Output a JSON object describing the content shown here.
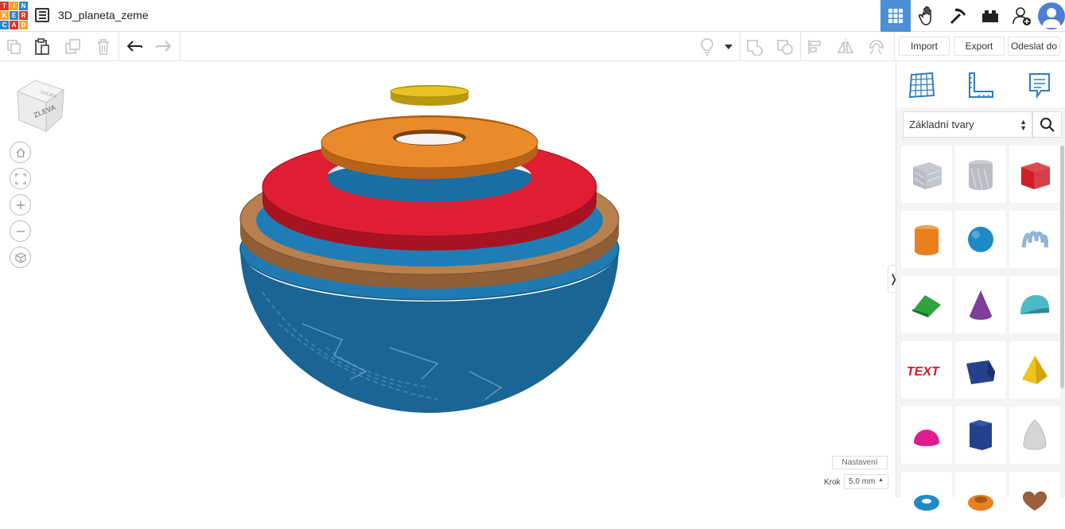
{
  "app": {
    "logo_letters": [
      "T",
      "I",
      "N",
      "K",
      "E",
      "R",
      "C",
      "A",
      "D"
    ],
    "logo_colors": [
      "#e2322b",
      "#f2a62b",
      "#2b86c7",
      "#f2a62b",
      "#2b86c7",
      "#e2322b",
      "#2b86c7",
      "#e2322b",
      "#f2a62b"
    ],
    "document_title": "3D_planeta_zeme"
  },
  "header_icons": [
    {
      "name": "3d-view-grid-icon",
      "active": true
    },
    {
      "name": "codeblocks-hand-icon",
      "active": false
    },
    {
      "name": "minecraft-pickaxe-icon",
      "active": false
    },
    {
      "name": "bricks-icon",
      "active": false
    },
    {
      "name": "add-user-icon",
      "active": false
    }
  ],
  "toolbar": {
    "import_label": "Import",
    "export_label": "Export",
    "send_label": "Odeslat do"
  },
  "viewcube": {
    "face_label": "ZLEVA",
    "top_label": "SHORA"
  },
  "workplane": {
    "settings_label": "Nastavení",
    "step_label": "Krok",
    "step_value": "5,0 mm"
  },
  "shapes_panel": {
    "category": "Základní tvary",
    "shapes": [
      {
        "name": "box-hole",
        "color": "#b9bcc4"
      },
      {
        "name": "cylinder-hole",
        "color": "#b9bcc4"
      },
      {
        "name": "box",
        "color": "#d01f28"
      },
      {
        "name": "cylinder",
        "color": "#e8801f"
      },
      {
        "name": "sphere",
        "color": "#1f8ac8"
      },
      {
        "name": "scribble",
        "color": "#8fb4d8"
      },
      {
        "name": "roof",
        "color": "#2fa33c"
      },
      {
        "name": "cone",
        "color": "#7e3e9a"
      },
      {
        "name": "round-roof",
        "color": "#4dbac8"
      },
      {
        "name": "text",
        "color": "#c8212b",
        "label": "TEXT"
      },
      {
        "name": "wedge",
        "color": "#24428c"
      },
      {
        "name": "pyramid",
        "color": "#f0c31d"
      },
      {
        "name": "half-sphere",
        "color": "#e01d8e"
      },
      {
        "name": "polygon",
        "color": "#24428c"
      },
      {
        "name": "paraboloid",
        "color": "#d5d5d5"
      },
      {
        "name": "torus",
        "color": "#1f8ac8"
      },
      {
        "name": "tube",
        "color": "#e8801f"
      },
      {
        "name": "heart",
        "color": "#9a5f3c"
      }
    ]
  },
  "model": {
    "layers": [
      {
        "name": "yellow-disk",
        "color": "#e6c320"
      },
      {
        "name": "orange-ring",
        "color": "#ea8a2a"
      },
      {
        "name": "red-ring",
        "color": "#df1e33"
      },
      {
        "name": "brown-ring",
        "color": "#b47d4d"
      },
      {
        "name": "blue-earth-hemisphere",
        "color": "#1a6ea3"
      }
    ]
  }
}
